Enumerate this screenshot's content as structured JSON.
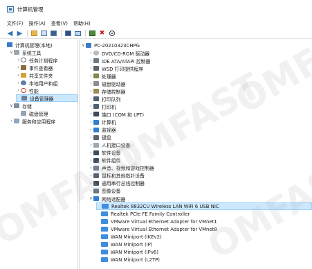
{
  "window": {
    "title": "计算机管理"
  },
  "menu": [
    "文件(F)",
    "操作(A)",
    "查看(V)",
    "帮助(H)"
  ],
  "toolbar": {
    "buttons": [
      "back",
      "forward",
      "up-folder",
      "show-hide-tree",
      "properties",
      "help",
      "monitor",
      "scan-hardware",
      "uninstall",
      "update"
    ]
  },
  "left_tree": [
    {
      "label": "计算机管理(本地)",
      "level": 0,
      "chev": "",
      "icon": "pc",
      "selected": false
    },
    {
      "label": "系统工具",
      "level": 1,
      "chev": "v",
      "icon": "tool",
      "selected": false
    },
    {
      "label": "任务计划程序",
      "level": 2,
      "chev": ">",
      "icon": "clock",
      "selected": false
    },
    {
      "label": "事件查看器",
      "level": 2,
      "chev": ">",
      "icon": "event",
      "selected": false
    },
    {
      "label": "共享文件夹",
      "level": 2,
      "chev": ">",
      "icon": "share",
      "selected": false
    },
    {
      "label": "本地用户和组",
      "level": 2,
      "chev": ">",
      "icon": "users",
      "selected": false
    },
    {
      "label": "性能",
      "level": 2,
      "chev": ">",
      "icon": "perf",
      "selected": false
    },
    {
      "label": "设备管理器",
      "level": 2,
      "chev": "",
      "icon": "devmgr",
      "selected": true
    },
    {
      "label": "存储",
      "level": 1,
      "chev": "v",
      "icon": "storage",
      "selected": false
    },
    {
      "label": "磁盘管理",
      "level": 2,
      "chev": "",
      "icon": "disk",
      "selected": false
    },
    {
      "label": "服务和应用程序",
      "level": 1,
      "chev": ">",
      "icon": "services",
      "selected": false
    }
  ],
  "right_tree": [
    {
      "label": "PC-20210323CHPG",
      "level": 0,
      "chev": "v",
      "icon": "pc",
      "selected": false
    },
    {
      "label": "DVD/CD-ROM 驱动器",
      "level": 1,
      "chev": ">",
      "icon": "dvd",
      "selected": false
    },
    {
      "label": "IDE ATA/ATAPI 控制器",
      "level": 1,
      "chev": ">",
      "icon": "ide",
      "selected": false
    },
    {
      "label": "WSD 打印提供程序",
      "level": 1,
      "chev": ">",
      "icon": "wsd",
      "selected": false
    },
    {
      "label": "处理器",
      "level": 1,
      "chev": ">",
      "icon": "cpu",
      "selected": false
    },
    {
      "label": "磁盘驱动器",
      "level": 1,
      "chev": ">",
      "icon": "diskdrv",
      "selected": false
    },
    {
      "label": "存储控制器",
      "level": 1,
      "chev": ">",
      "icon": "ctrl",
      "selected": false
    },
    {
      "label": "打印队列",
      "level": 1,
      "chev": ">",
      "icon": "print",
      "selected": false
    },
    {
      "label": "打印机",
      "level": 1,
      "chev": ">",
      "icon": "print",
      "selected": false
    },
    {
      "label": "端口 (COM 和 LPT)",
      "level": 1,
      "chev": ">",
      "icon": "port",
      "selected": false
    },
    {
      "label": "计算机",
      "level": 1,
      "chev": ">",
      "icon": "monitor",
      "selected": false
    },
    {
      "label": "监视器",
      "level": 1,
      "chev": ">",
      "icon": "monitor",
      "selected": false
    },
    {
      "label": "键盘",
      "level": 1,
      "chev": ">",
      "icon": "keyboard",
      "selected": false
    },
    {
      "label": "人机接口设备",
      "level": 1,
      "chev": ">",
      "icon": "hid",
      "selected": false
    },
    {
      "label": "软件设备",
      "level": 1,
      "chev": ">",
      "icon": "software",
      "selected": false
    },
    {
      "label": "软件组件",
      "level": 1,
      "chev": ">",
      "icon": "software",
      "selected": false
    },
    {
      "label": "声音、视频和游戏控制器",
      "level": 1,
      "chev": ">",
      "icon": "audio",
      "selected": false
    },
    {
      "label": "鼠标和其他指针设备",
      "level": 1,
      "chev": ">",
      "icon": "mouse",
      "selected": false
    },
    {
      "label": "通用串行总线控制器",
      "level": 1,
      "chev": ">",
      "icon": "usb",
      "selected": false
    },
    {
      "label": "图像设备",
      "level": 1,
      "chev": ">",
      "icon": "image",
      "selected": false
    },
    {
      "label": "网络适配器",
      "level": 1,
      "chev": "v",
      "icon": "net",
      "selected": false
    },
    {
      "label": "Realtek 8832CU Wireless LAN WiFi 6 USB NIC",
      "level": 2,
      "chev": "",
      "icon": "nic",
      "selected": true
    },
    {
      "label": "Realtek PCIe FE Family Controller",
      "level": 2,
      "chev": "",
      "icon": "nic",
      "selected": false
    },
    {
      "label": "VMware Virtual Ethernet Adapter for VMnet1",
      "level": 2,
      "chev": "",
      "icon": "nic",
      "selected": false
    },
    {
      "label": "VMware Virtual Ethernet Adapter for VMnet8",
      "level": 2,
      "chev": "",
      "icon": "nic",
      "selected": false
    },
    {
      "label": "WAN Miniport (IKEv2)",
      "level": 2,
      "chev": "",
      "icon": "nic",
      "selected": false
    },
    {
      "label": "WAN Miniport (IP)",
      "level": 2,
      "chev": "",
      "icon": "nic",
      "selected": false
    },
    {
      "label": "WAN Miniport (IPv6)",
      "level": 2,
      "chev": "",
      "icon": "nic",
      "selected": false
    },
    {
      "label": "WAN Miniport (L2TP)",
      "level": 2,
      "chev": "",
      "icon": "nic",
      "selected": false
    }
  ],
  "watermark_text": "OMFAST",
  "colors": {
    "selection": "#cce8ff",
    "accent": "#2f6fb5"
  }
}
